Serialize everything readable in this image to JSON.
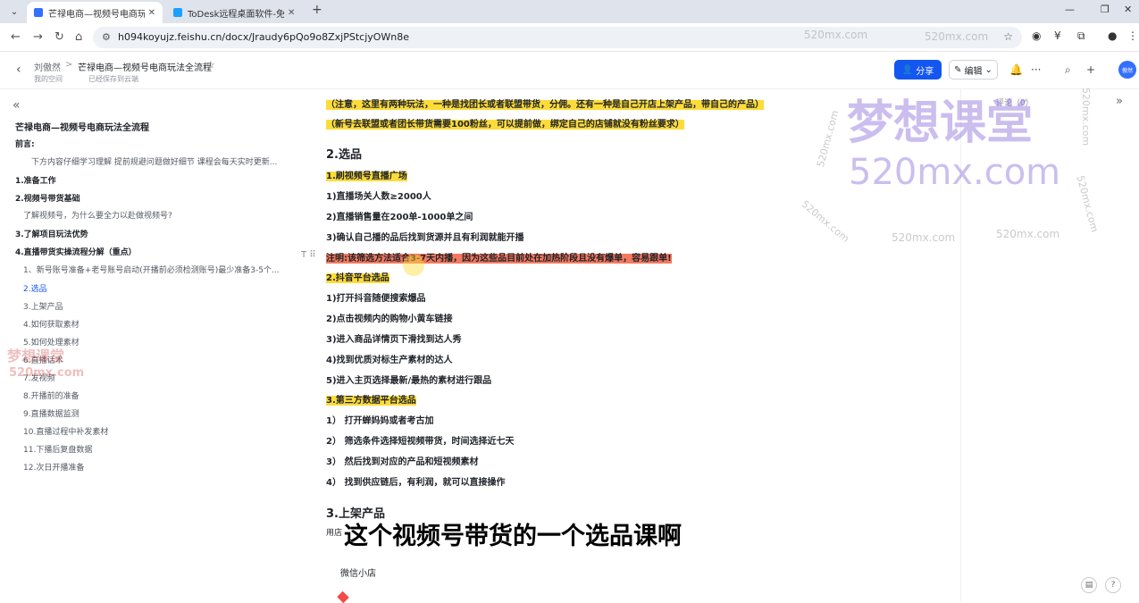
{
  "browser": {
    "tabs": [
      {
        "title": "芒禄电商—视频号电商玩法全流程",
        "active": true,
        "color": "#3370ff"
      },
      {
        "title": "ToDesk远程桌面软件-免费安全",
        "active": false,
        "color": "#1aa1ff"
      }
    ],
    "url": "h094koyujz.feishu.cn/docx/Jraudy6pQo9o8ZxjPStcjyOWn8e"
  },
  "header": {
    "breadcrumb_parent": "刘傲然",
    "breadcrumb_sep": ">",
    "doc_title": "芒禄电商—视频号电商玩法全流程",
    "space": "我的空间",
    "saved": "已经保存到云端",
    "share_label": "分享",
    "edit_label": "编辑",
    "avatar_label": "傲然"
  },
  "sidebar": {
    "title": "芒禄电商—视频号电商玩法全流程",
    "items": [
      {
        "label": "前言:",
        "level": "h1"
      },
      {
        "label": "下方内容仔细学习理解 提前规避问题做好细节 课程会每天实时更新...",
        "level": "lvl3"
      },
      {
        "label": "1.准备工作",
        "level": "h1"
      },
      {
        "label": "2.视频号带货基础",
        "level": "h1"
      },
      {
        "label": "了解视频号，为什么要全力以赴做视频号?",
        "level": "lvl2"
      },
      {
        "label": "3.了解项目玩法优势",
        "level": "h1"
      },
      {
        "label": "4.直播带货实操流程分解（重点）",
        "level": "h1"
      },
      {
        "label": "1、新号账号准备+老号账号启动(开播前必须检测账号)最少准备3-5个...",
        "level": "lvl2"
      },
      {
        "label": "2.选品",
        "level": "active"
      },
      {
        "label": "3.上架产品",
        "level": "lvl2"
      },
      {
        "label": "4.如何获取素材",
        "level": "lvl2"
      },
      {
        "label": "5.如何处理素材",
        "level": "lvl2"
      },
      {
        "label": "6.直播话术",
        "level": "lvl2"
      },
      {
        "label": "7.发视频",
        "level": "lvl2"
      },
      {
        "label": "8.开播前的准备",
        "level": "lvl2"
      },
      {
        "label": "9.直播数据监测",
        "level": "lvl2"
      },
      {
        "label": "10.直播过程中补发素材",
        "level": "lvl2"
      },
      {
        "label": "11.下播后复盘数据",
        "level": "lvl2"
      },
      {
        "label": "12.次日开播准备",
        "level": "lvl2"
      }
    ]
  },
  "content": {
    "lines": [
      {
        "text": "（注意，这里有两种玩法，一种是找团长或者联盟带货，分佣。还有一种是自己开店上架产品，带自己的产品）",
        "style": "yellow"
      },
      {
        "text": "（新号去联盟或者团长带货需要100粉丝，可以提前做，绑定自己的店铺就没有粉丝要求）",
        "style": "yellow"
      },
      {
        "text": "2.选品",
        "style": "h2"
      },
      {
        "text": "1.刷视频号直播广场",
        "style": "yellow"
      },
      {
        "text": "1)直播场关人数≥2000人",
        "style": "bold"
      },
      {
        "text": "2)直播销售量在200单-1000单之间",
        "style": "bold"
      },
      {
        "text": "3)确认自己播的品后找到货源并且有利润就能开播",
        "style": "bold"
      },
      {
        "text": "注明:该筛选方法适合3-7天内播，因为这些品目前处在加热阶段且没有爆单，容易跟单!",
        "style": "red"
      },
      {
        "text": "2.抖音平台选品",
        "style": "yellow"
      },
      {
        "text": "1)打开抖音随便搜索爆品",
        "style": "bold"
      },
      {
        "text": "2)点击视频内的购物小黄车链接",
        "style": "bold"
      },
      {
        "text": "3)进入商品详情页下滑找到达人秀",
        "style": "bold"
      },
      {
        "text": "4)找到优质对标生产素材的达人",
        "style": "bold"
      },
      {
        "text": "5)进入主页选择最新/最热的素材进行跟品",
        "style": "bold"
      },
      {
        "text": "3.第三方数据平台选品",
        "style": "yellow"
      },
      {
        "text": "1） 打开蝉妈妈或者考古加",
        "style": "bold"
      },
      {
        "text": "2） 筛选条件选择短视频带货，时间选择近七天",
        "style": "bold"
      },
      {
        "text": "3） 然后找到对应的产品和短视频素材",
        "style": "bold"
      },
      {
        "text": "4） 找到供应链后，有利润，就可以直接操作",
        "style": "bold"
      },
      {
        "text": "3.上架产品",
        "style": "h2"
      },
      {
        "text": "用店",
        "style": "normal"
      },
      {
        "text": "微信小店",
        "style": "normal"
      }
    ],
    "caption": "这个视频号带货的一个选品课啊"
  },
  "right_panel": {
    "comment_label": "评论（0）"
  },
  "watermarks": {
    "brand_cn": "梦想课堂",
    "brand_domain": "520mx.com"
  }
}
